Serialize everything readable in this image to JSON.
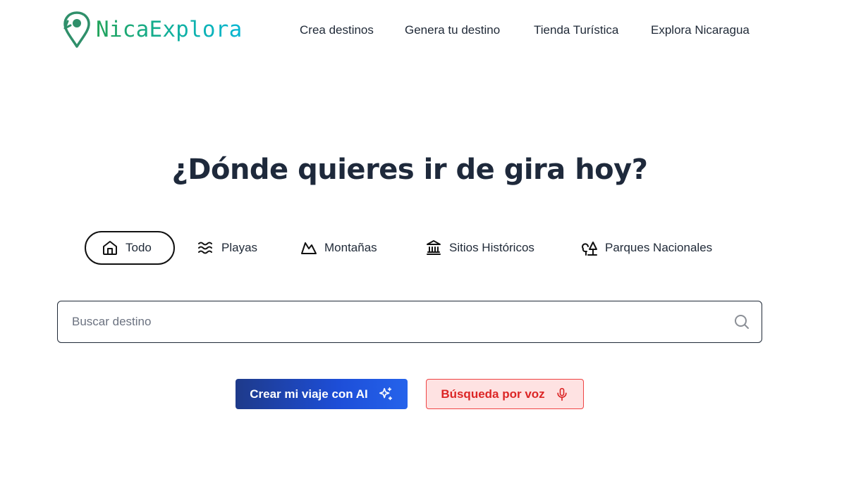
{
  "brand": {
    "name": "NicaExplora"
  },
  "nav": {
    "items": [
      "Crea destinos",
      "Genera tu destino",
      "Tienda Turística",
      "Explora Nicaragua"
    ]
  },
  "hero": {
    "title": "¿Dónde quieres ir de gira hoy?"
  },
  "categories": [
    {
      "label": "Todo",
      "icon": "home-icon",
      "active": true
    },
    {
      "label": "Playas",
      "icon": "waves-icon",
      "active": false
    },
    {
      "label": "Montañas",
      "icon": "mountain-icon",
      "active": false
    },
    {
      "label": "Sitios Históricos",
      "icon": "landmark-icon",
      "active": false
    },
    {
      "label": "Parques Nacionales",
      "icon": "trees-icon",
      "active": false
    }
  ],
  "search": {
    "placeholder": "Buscar destino",
    "value": ""
  },
  "actions": {
    "ai_label": "Crear mi viaje con AI",
    "voice_label": "Búsqueda por voz"
  },
  "colors": {
    "brand_green": "#22a35a",
    "brand_teal": "#06b6d4",
    "ai_button": "#1d4ed8",
    "voice_text": "#dc2626",
    "voice_bg": "#fee2e2",
    "title": "#1e293b"
  }
}
